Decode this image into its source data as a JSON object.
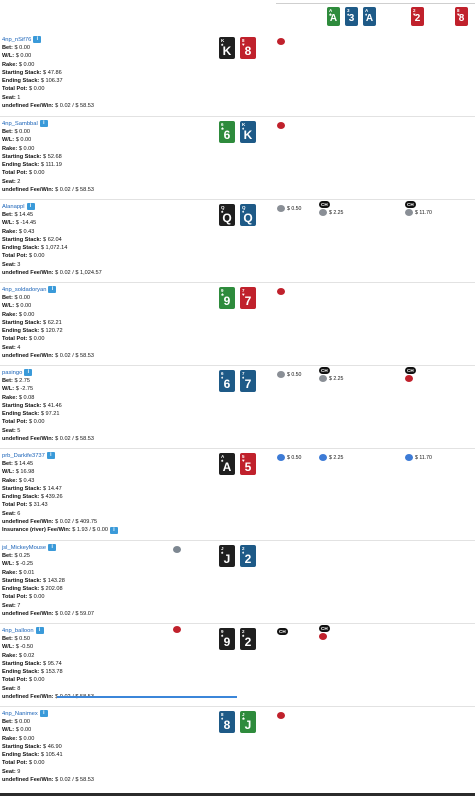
{
  "colors": {
    "link": "#1a63b8",
    "spade": "#1f1f1f",
    "heart": "#c0212c",
    "club": "#2e8b3c",
    "diamond": "#1e5a87"
  },
  "board": [
    {
      "rank": "A",
      "suit": "clubs"
    },
    {
      "rank": "3",
      "suit": "diamonds"
    },
    {
      "rank": "A",
      "suit": "diamonds"
    },
    {
      "rank": "2",
      "suit": "hearts"
    },
    {
      "rank": "8",
      "suit": "hearts"
    }
  ],
  "players": [
    {
      "name": "4np_nSif76",
      "bet": "$ 0.00",
      "wl": "$ 0.00",
      "rake": "$ 0.00",
      "start": "$ 47.86",
      "end": "$ 106.37",
      "pot": "$ 0.00",
      "seat": "1",
      "fee": "$ 0.02 / $ 58.53",
      "cards": [
        {
          "rank": "K",
          "suit": "spades"
        },
        {
          "rank": "8",
          "suit": "hearts"
        }
      ]
    },
    {
      "name": "4np_Sambbal",
      "bet": "$ 0.00",
      "wl": "$ 0.00",
      "rake": "$ 0.00",
      "start": "$ 52.68",
      "end": "$ 111.19",
      "pot": "$ 0.00",
      "seat": "2",
      "fee": "$ 0.02 / $ 58.53",
      "cards": [
        {
          "rank": "6",
          "suit": "clubs"
        },
        {
          "rank": "K",
          "suit": "diamonds"
        }
      ]
    },
    {
      "name": "Alanappl",
      "bet": "$ 14.45",
      "wl": "$ -14.45",
      "rake": "$ 0.43",
      "start": "$ 62.04",
      "end": "$ 1,072.14",
      "pot": "$ 0.00",
      "seat": "3",
      "fee": "$ 0.02 / $ 1,024.57",
      "cards": [
        {
          "rank": "Q",
          "suit": "spades"
        },
        {
          "rank": "Q",
          "suit": "diamonds"
        }
      ],
      "preflop": "$ 0.50",
      "flop_ch": "CH",
      "flop": "$ 2.25",
      "turn_ch": "CH",
      "turn": "$ 11.70"
    },
    {
      "name": "4np_soldadoryan",
      "bet": "$ 0.00",
      "wl": "$ 0.00",
      "rake": "$ 0.00",
      "start": "$ 62.21",
      "end": "$ 120.72",
      "pot": "$ 0.00",
      "seat": "4",
      "fee": "$ 0.02 / $ 58.53",
      "cards": [
        {
          "rank": "9",
          "suit": "clubs"
        },
        {
          "rank": "7",
          "suit": "hearts"
        }
      ]
    },
    {
      "name": "pasingo",
      "bet": "$ 2.75",
      "wl": "$ -2.75",
      "rake": "$ 0.08",
      "start": "$ 41.46",
      "end": "$ 97.21",
      "pot": "$ 0.00",
      "seat": "5",
      "fee": "$ 0.02 / $ 58.53",
      "cards": [
        {
          "rank": "6",
          "suit": "diamonds"
        },
        {
          "rank": "7",
          "suit": "diamonds"
        }
      ],
      "preflop": "$ 0.50",
      "flop_ch": "CH",
      "flop": "$ 2.25",
      "turn_ch": "CH"
    },
    {
      "name": "prb_Darkife3737",
      "bet": "$ 14.45",
      "wl": "$ 16.98",
      "rake": "$ 0.43",
      "start": "$ 14.47",
      "end": "$ 439.26",
      "pot": "$ 31.43",
      "seat": "6",
      "fee": "$ 0.02 / $ 409.75",
      "insurance_label": "Insurance (river) Fee/Win:",
      "insurance": "$ 1.93 / $ 0.00",
      "cards": [
        {
          "rank": "A",
          "suit": "spades"
        },
        {
          "rank": "5",
          "suit": "hearts"
        }
      ],
      "preflop": "$ 0.50",
      "flop": "$ 2.25",
      "turn": "$ 11.70"
    },
    {
      "name": "jsl_MickeyMouse",
      "bet": "$ 0.25",
      "wl": "$ -0.25",
      "rake": "$ 0.01",
      "start": "$ 143.28",
      "end": "$ 202.08",
      "pot": "$ 0.00",
      "seat": "7",
      "fee": "$ 0.02 / $ 59.07",
      "cards": [
        {
          "rank": "J",
          "suit": "spades"
        },
        {
          "rank": "2",
          "suit": "diamonds"
        }
      ]
    },
    {
      "name": "4np_balloon",
      "bet": "$ 0.50",
      "wl": "$ -0.50",
      "rake": "$ 0.02",
      "start": "$ 95.74",
      "end": "$ 153.78",
      "pot": "$ 0.00",
      "seat": "8",
      "fee": "$ 0.02 / $ 58.53",
      "cards": [
        {
          "rank": "9",
          "suit": "spades"
        },
        {
          "rank": "2",
          "suit": "spades"
        }
      ],
      "preflop_ch": "CH",
      "flop_ch": "CH"
    },
    {
      "name": "4np_Nanimex",
      "bet": "$ 0.00",
      "wl": "$ 0.00",
      "rake": "$ 0.00",
      "start": "$ 46.90",
      "end": "$ 105.41",
      "pot": "$ 0.00",
      "seat": "9",
      "fee": "$ 0.02 / $ 58.53",
      "cards": [
        {
          "rank": "8",
          "suit": "diamonds"
        },
        {
          "rank": "J",
          "suit": "clubs"
        }
      ]
    }
  ],
  "labels": {
    "bet": "Bet:",
    "wl": "W/L:",
    "rake": "Rake:",
    "start": "Starting Stack:",
    "end": "Ending Stack:",
    "pot": "Total Pot:",
    "seat": "Seat:",
    "fee": "undefined Fee/Win:",
    "info": "i"
  }
}
